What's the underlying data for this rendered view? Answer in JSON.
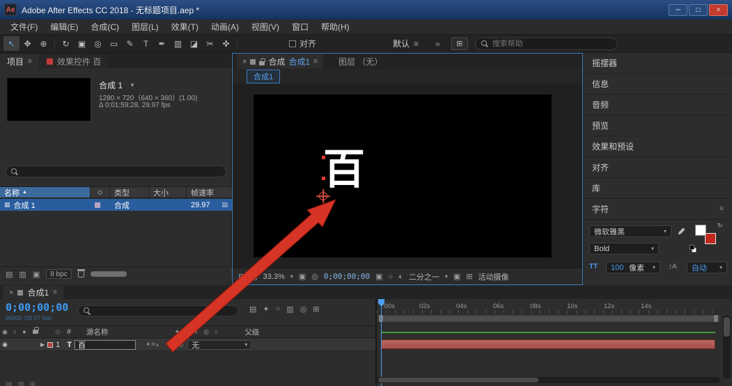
{
  "window": {
    "title": "Adobe After Effects CC 2018 - 无标题项目.aep *",
    "badge": "Ae"
  },
  "menu": {
    "items": [
      "文件(F)",
      "编辑(E)",
      "合成(C)",
      "图层(L)",
      "效果(T)",
      "动画(A)",
      "视图(V)",
      "窗口",
      "帮助(H)"
    ]
  },
  "toolbar": {
    "tools": [
      {
        "name": "selection",
        "g": "↖"
      },
      {
        "name": "hand",
        "g": "✥"
      },
      {
        "name": "zoom",
        "g": "⊕"
      },
      {
        "name": "orbit",
        "g": "↻"
      },
      {
        "name": "camera",
        "g": "▣"
      },
      {
        "name": "pan-behind",
        "g": "◎"
      },
      {
        "name": "shape",
        "g": "▭"
      },
      {
        "name": "pen",
        "g": "✎"
      },
      {
        "name": "type",
        "g": "T"
      },
      {
        "name": "brush",
        "g": "✒"
      },
      {
        "name": "clone-stamp",
        "g": "▥"
      },
      {
        "name": "eraser",
        "g": "◪"
      },
      {
        "name": "roto-brush",
        "g": "✂"
      },
      {
        "name": "puppet",
        "g": "✜"
      }
    ],
    "snap_label": "对齐",
    "workspace_label": "默认",
    "overflow": "»",
    "search_placeholder": "搜索帮助"
  },
  "icons": {
    "menu": "≡",
    "dd": "▾",
    "ddl": "▼",
    "close": "×",
    "min": "─",
    "max": "□",
    "sort": "▲",
    "twirl": "▶",
    "eye": "◉",
    "target": "◎",
    "solo": "●",
    "tag": "◇",
    "hash": "#",
    "star": "✦",
    "burst": "✳",
    "half": "◐",
    "ring": "○",
    "film": "▦",
    "grid": "▤",
    "grid2": "▥",
    "box": "▣",
    "plus": "⊞",
    "swap": "↻",
    "note": "♪",
    "tt": "TT",
    "leading": "↕A"
  },
  "project": {
    "tab_project": "项目",
    "tab_effects": "效果控件 百",
    "comp_name": "合成 1",
    "info_line1": "1280 × 720（640 × 360）(1.00)",
    "info_line2": "Δ 0;01;59;28, 29.97 fps",
    "columns": [
      "名称",
      "类型",
      "大小",
      "帧速率"
    ],
    "row": {
      "name": "合成 1",
      "type": "合成",
      "rate": "29.97"
    },
    "bpc": "8 bpc"
  },
  "comp": {
    "tab_prefix": "合成",
    "tab_name": "合成1",
    "tab_layer": "图层 （无）",
    "subtab": "合成1",
    "canvas_text": "百",
    "zoom": "33.3%",
    "timecode": "0;00;00;00",
    "resolution": "二分之一",
    "camera_label": "活动摄像"
  },
  "panels": {
    "items": [
      "摇摆器",
      "信息",
      "音频",
      "预览",
      "效果和预设",
      "对齐",
      "库"
    ]
  },
  "character": {
    "title": "字符",
    "font": "微软雅黑",
    "style": "Bold",
    "size": "100",
    "size_unit": "像素",
    "leading": "自动"
  },
  "timeline": {
    "tab": "合成1",
    "timecode": "0;00;00;00",
    "frames": "00000 (29.97 fps)",
    "col_source": "源名称",
    "col_parent": "父级",
    "layer": {
      "index": "1",
      "type": "T",
      "name": "百",
      "parent": "无"
    },
    "ticks": [
      ":00s",
      "02s",
      "04s",
      "06s",
      "08s",
      "10s",
      "12s",
      "14s"
    ]
  }
}
